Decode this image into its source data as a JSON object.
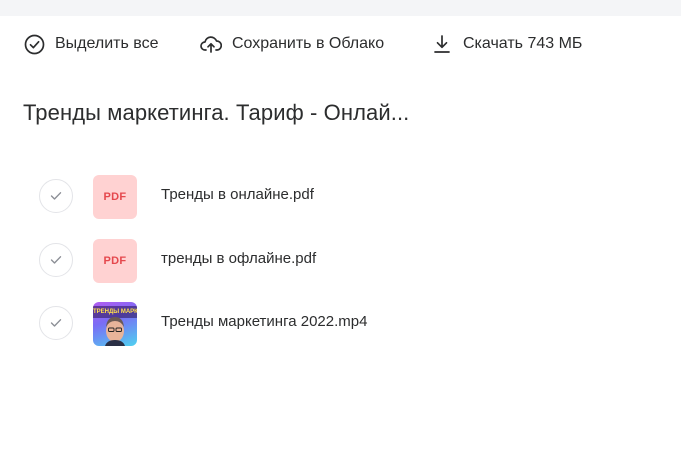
{
  "toolbar": {
    "select_all": {
      "label": "Выделить все",
      "icon": "check-circle-icon"
    },
    "save_to_cloud": {
      "label": "Сохранить в Облако",
      "icon": "cloud-upload-icon"
    },
    "download": {
      "label": "Скачать 743 МБ",
      "icon": "download-icon"
    }
  },
  "folder": {
    "title": "Тренды маркетинга. Тариф - Онлай..."
  },
  "files": [
    {
      "name": "Тренды в онлайне.pdf",
      "type": "pdf",
      "thumb_label": "PDF",
      "icon": "pdf-file-icon"
    },
    {
      "name": "тренды в офлайне.pdf",
      "type": "pdf",
      "thumb_label": "PDF",
      "icon": "pdf-file-icon"
    },
    {
      "name": "Тренды маркетинга 2022.mp4",
      "type": "video",
      "thumb_label": "ТРЕНДЫ МАРКЕТИНГА",
      "icon": "video-thumbnail-icon"
    }
  ],
  "colors": {
    "text": "#2c2d2e",
    "pdf_bg": "#ffd2d2",
    "pdf_text": "#e5484d",
    "checkbox_border": "#e3e4e8",
    "top_strip": "#f4f5f7"
  }
}
